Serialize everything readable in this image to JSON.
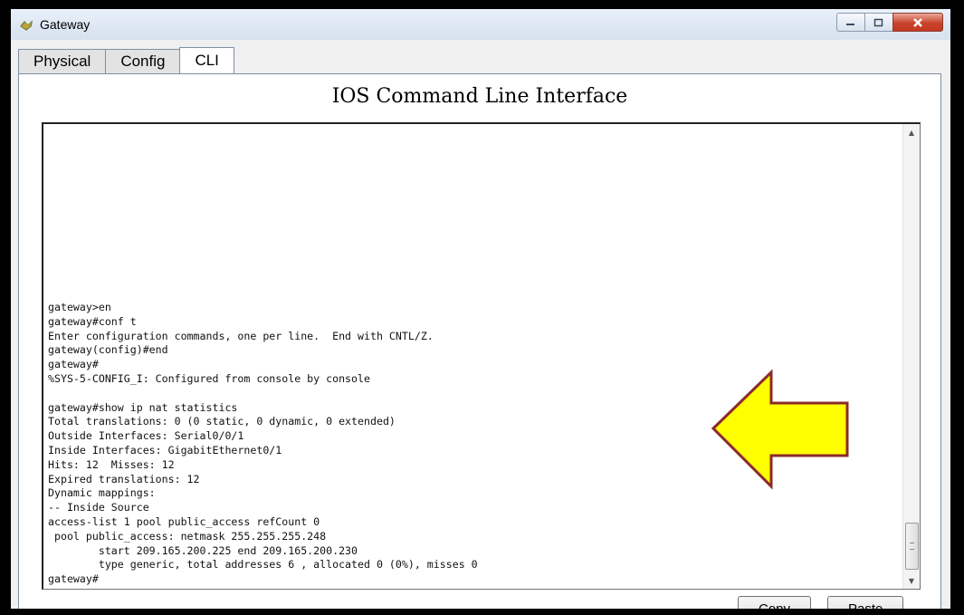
{
  "window": {
    "title": "Gateway",
    "buttons": [
      "minimize",
      "maximize",
      "close"
    ]
  },
  "tabs": [
    {
      "label": "Physical",
      "active": false
    },
    {
      "label": "Config",
      "active": false
    },
    {
      "label": "CLI",
      "active": true
    }
  ],
  "cli": {
    "title": "IOS Command Line Interface",
    "lines": [
      "gateway>en",
      "gateway#conf t",
      "Enter configuration commands, one per line.  End with CNTL/Z.",
      "gateway(config)#end",
      "gateway#",
      "%SYS-5-CONFIG_I: Configured from console by console",
      "",
      "gateway#show ip nat statistics",
      "Total translations: 0 (0 static, 0 dynamic, 0 extended)",
      "Outside Interfaces: Serial0/0/1",
      "Inside Interfaces: GigabitEthernet0/1",
      "Hits: 12  Misses: 12",
      "Expired translations: 12",
      "Dynamic mappings:",
      "-- Inside Source",
      "access-list 1 pool public_access refCount 0",
      " pool public_access: netmask 255.255.255.248",
      "        start 209.165.200.225 end 209.165.200.230",
      "        type generic, total addresses 6 , allocated 0 (0%), misses 0",
      "gateway#"
    ]
  },
  "buttons": {
    "copy": "Copy",
    "paste": "Paste"
  },
  "colors": {
    "arrow_fill": "#ffff00",
    "arrow_stroke": "#8b2a2a"
  }
}
